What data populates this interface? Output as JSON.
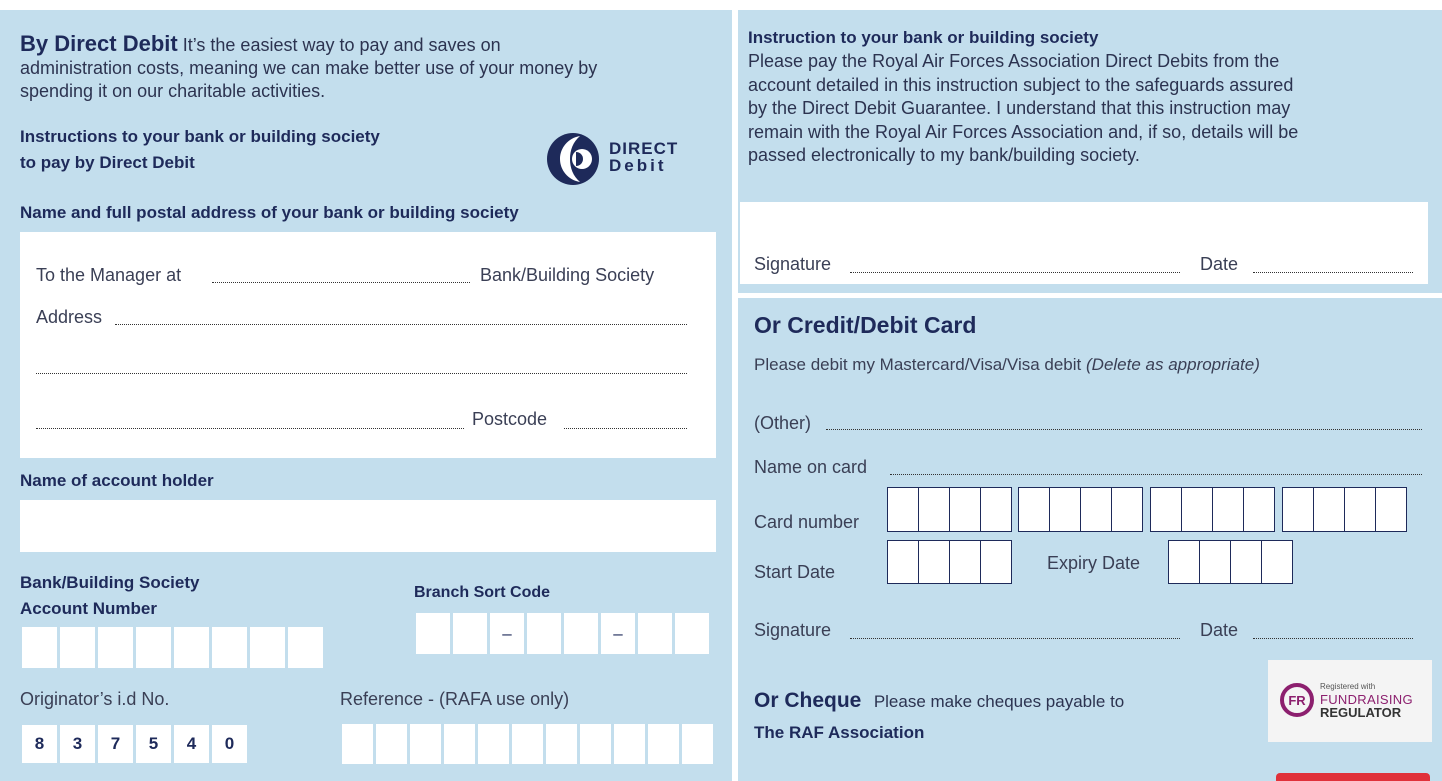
{
  "left": {
    "intro_heading": "By Direct Debit",
    "intro_line1": "It’s the easiest way to pay and saves on",
    "intro_line2": "administration costs, meaning we can make better use of your money by",
    "intro_line3": "spending it on our charitable activities.",
    "instructions_line1": "Instructions to your bank or building society",
    "instructions_line2": "to pay by Direct Debit",
    "logo_word1": "DIRECT",
    "logo_word2": "Debit",
    "bank_section_label": "Name and full postal address of your bank or building society",
    "to_manager_label": "To the Manager at",
    "bank_building_label": "Bank/Building Society",
    "address_label": "Address",
    "postcode_label": "Postcode",
    "account_holder_label": "Name of account holder",
    "account_number_line1": "Bank/Building Society",
    "account_number_line2": "Account Number",
    "sort_code_label": "Branch Sort Code",
    "sort_code_sep": "–",
    "originator_label": "Originator’s i.d No.",
    "originator_digits": [
      "8",
      "3",
      "7",
      "5",
      "4",
      "0"
    ],
    "reference_label": "Reference - (RAFA use only)"
  },
  "right": {
    "instruction_heading": "Instruction to your bank or building society",
    "instruction_line1": "Please pay the Royal Air Forces Association Direct Debits from the",
    "instruction_line2": "account detailed in this instruction subject to the safeguards assured",
    "instruction_line3": "by the Direct Debit Guarantee. I understand that this instruction may",
    "instruction_line4": "remain with the Royal Air Forces Association and, if so, details will be",
    "instruction_line5": "passed electronically to my bank/building society.",
    "signature_label": "Signature",
    "date_label": "Date",
    "card_heading": "Or Credit/Debit Card",
    "card_instruction": "Please debit my Mastercard/Visa/Visa debit",
    "card_instruction_note": "(Delete as appropriate)",
    "other_label": "(Other)",
    "name_on_card_label": "Name on card",
    "card_number_label": "Card number",
    "start_date_label": "Start Date",
    "expiry_date_label": "Expiry Date",
    "card_signature_label": "Signature",
    "card_date_label": "Date",
    "cheque_heading": "Or Cheque",
    "cheque_text": "Please make cheques payable to",
    "cheque_payee": "The RAF Association",
    "fr_logo_mark": "FR",
    "fr_registered": "Registered with",
    "fr_line1": "FUNDRAISING",
    "fr_line2": "REGULATOR"
  },
  "colors": {
    "panel": "#c3deed",
    "navy": "#1e2a5a",
    "fr_purple": "#8c1f6e",
    "red_tab": "#e0313a"
  }
}
